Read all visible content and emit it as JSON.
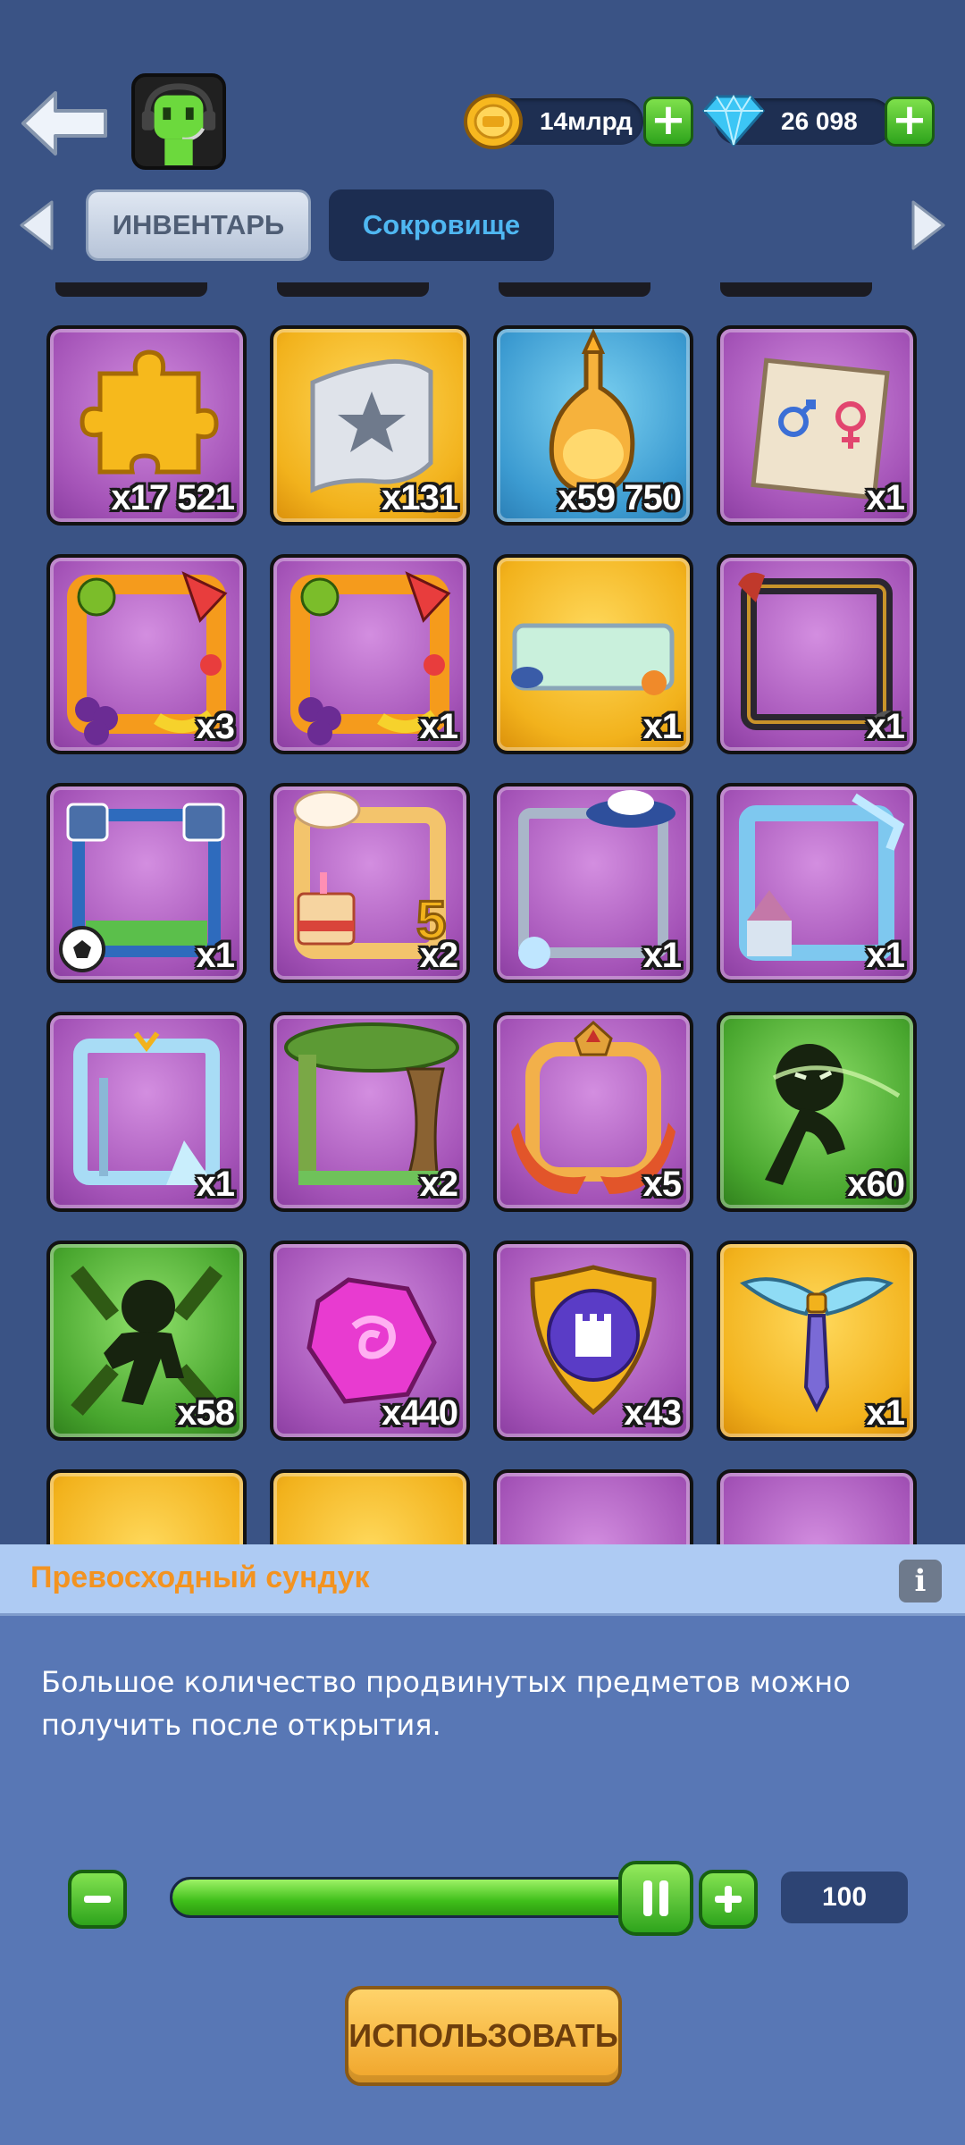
{
  "header": {
    "gold_amount": "14млрд",
    "gems_amount": "26 098"
  },
  "tabs": {
    "inventory": "ИНВЕНТАРЬ",
    "treasure": "Сокровище"
  },
  "items": [
    {
      "icon": "puzzle-piece-icon",
      "count": "x17 521"
    },
    {
      "icon": "star-ticket-icon",
      "count": "x131"
    },
    {
      "icon": "potion-bottle-icon",
      "count": "x59 750"
    },
    {
      "icon": "gender-swap-note-icon",
      "count": "x1"
    },
    {
      "icon": "fruit-frame-icon",
      "count": "x3"
    },
    {
      "icon": "fruit-frame-icon",
      "count": "x1"
    },
    {
      "icon": "vip-nameplate-icon",
      "count": "x1"
    },
    {
      "icon": "dark-frame-icon",
      "count": "x1"
    },
    {
      "icon": "football-frame-icon",
      "count": "x1"
    },
    {
      "icon": "birthday-cake-frame-icon",
      "count": "x2"
    },
    {
      "icon": "hat-frame-icon",
      "count": "x1"
    },
    {
      "icon": "ice-castle-frame-icon",
      "count": "x1"
    },
    {
      "icon": "ice-sword-frame-icon",
      "count": "x1"
    },
    {
      "icon": "forest-frame-icon",
      "count": "x2"
    },
    {
      "icon": "crown-ribbon-frame-icon",
      "count": "x5"
    },
    {
      "icon": "shadow-runner-icon",
      "count": "x60"
    },
    {
      "icon": "shadow-dancer-icon",
      "count": "x58"
    },
    {
      "icon": "pink-gem-icon",
      "count": "x440"
    },
    {
      "icon": "castle-shield-icon",
      "count": "x43"
    },
    {
      "icon": "winged-sword-icon",
      "count": "x1"
    }
  ],
  "panel": {
    "title": "Превосходный сундук",
    "info": "i",
    "description": "Большое количество продвинутых предметов можно получить после открытия.",
    "quantity": "100",
    "use_label": "ИСПОЛЬЗОВАТЬ",
    "slider_fraction": 1.0
  },
  "colors": {
    "background": "#3a5385",
    "title_orange": "#f39320",
    "accent_green": "#3fbf1a"
  }
}
